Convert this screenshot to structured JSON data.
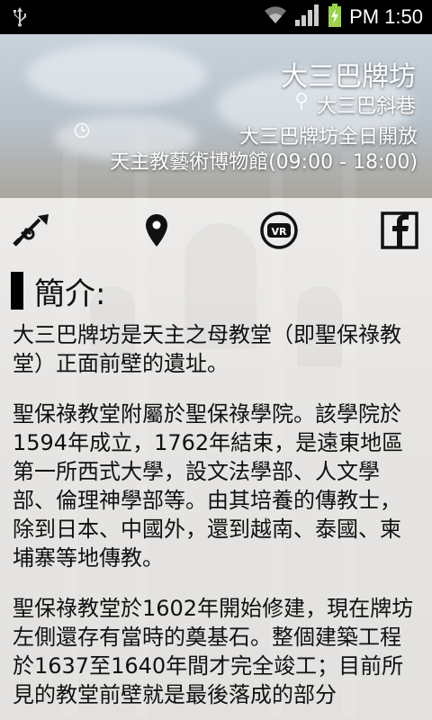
{
  "status_bar": {
    "time": "PM 1:50"
  },
  "header": {
    "title": "大三巴牌坊",
    "location": "大三巴斜巷",
    "hours_line1": "大三巴牌坊全日開放",
    "hours_line2": "天主教藝術博物館(09:00 - 18:00)"
  },
  "actions": [
    {
      "icon": "trumpet-icon"
    },
    {
      "icon": "map-pin-icon"
    },
    {
      "icon": "vr-icon"
    },
    {
      "icon": "facebook-icon"
    }
  ],
  "intro": {
    "heading": "簡介:",
    "paragraphs": [
      "大三巴牌坊是天主之母教堂（即聖保祿教堂）正面前壁的遺址。",
      "聖保祿教堂附屬於聖保祿學院。該學院於1594年成立，1762年結束，是遠東地區第一所西式大學，設文法學部、人文學部、倫理神學部等。由其培養的傳教士，除到日本、中國外，還到越南、泰國、柬埔寨等地傳教。",
      "聖保祿教堂於1602年開始修建，現在牌坊左側還存有當時的奠基石。整個建築工程於1637至1640年間才完全竣工；目前所見的教堂前壁就是最後落成的部分"
    ]
  }
}
